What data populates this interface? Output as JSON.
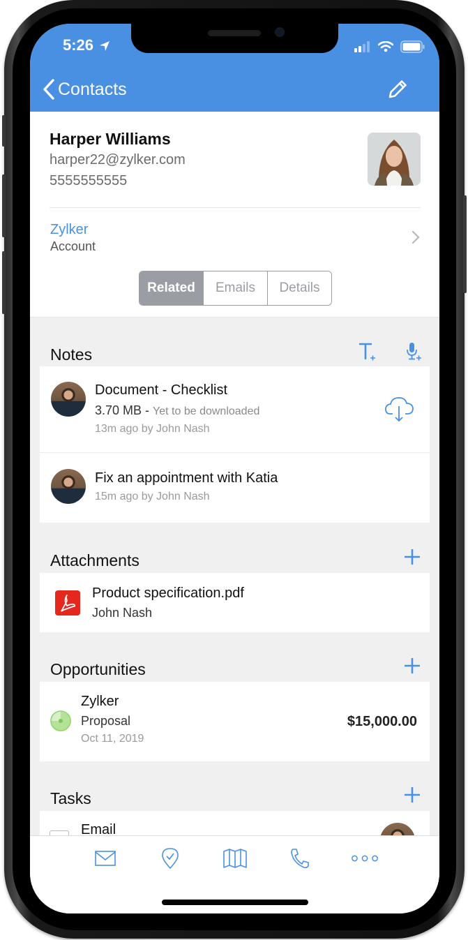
{
  "status_bar": {
    "time": "5:26"
  },
  "nav": {
    "back_label": "Contacts",
    "back_icon": "chevron-left-icon",
    "edit_icon": "pencil-icon"
  },
  "contact": {
    "name": "Harper Williams",
    "email": "harper22@zylker.com",
    "phone": "5555555555",
    "account_name": "Zylker",
    "account_label": "Account"
  },
  "segments": {
    "items": [
      "Related",
      "Emails",
      "Details"
    ],
    "active": "Related"
  },
  "notes": {
    "title": "Notes",
    "actions": [
      "add-text-note-icon",
      "add-voice-note-icon"
    ],
    "items": [
      {
        "title": "Document - Checklist",
        "size": "3.70 MB",
        "separator": " - ",
        "status": "Yet to be downloaded",
        "meta": "13m ago by John Nash",
        "action_icon": "cloud-download-icon"
      },
      {
        "title": "Fix an appointment with Katia",
        "meta": "15m ago by John Nash"
      }
    ]
  },
  "attachments": {
    "title": "Attachments",
    "items": [
      {
        "name": "Product specification.pdf",
        "owner": "John Nash",
        "icon": "pdf-icon"
      }
    ]
  },
  "opportunities": {
    "title": "Opportunities",
    "items": [
      {
        "name": "Zylker",
        "stage": "Proposal",
        "date": "Oct 11, 2019",
        "amount": "$15,000.00",
        "stage_progress": 0.75
      }
    ]
  },
  "tasks": {
    "title": "Tasks",
    "items": [
      {
        "title": "Email",
        "done": false
      }
    ]
  },
  "tabbar": {
    "items": [
      {
        "name": "mail",
        "icon": "mail-icon"
      },
      {
        "name": "check-in",
        "icon": "location-check-icon"
      },
      {
        "name": "map",
        "icon": "map-icon"
      },
      {
        "name": "call",
        "icon": "phone-icon"
      },
      {
        "name": "more",
        "icon": "more-icon"
      }
    ]
  },
  "colors": {
    "accent": "#4a90e2",
    "segment_active": "#9a9ea4",
    "pdf_red": "#e4281d",
    "stage_green": "#8dd26b"
  }
}
